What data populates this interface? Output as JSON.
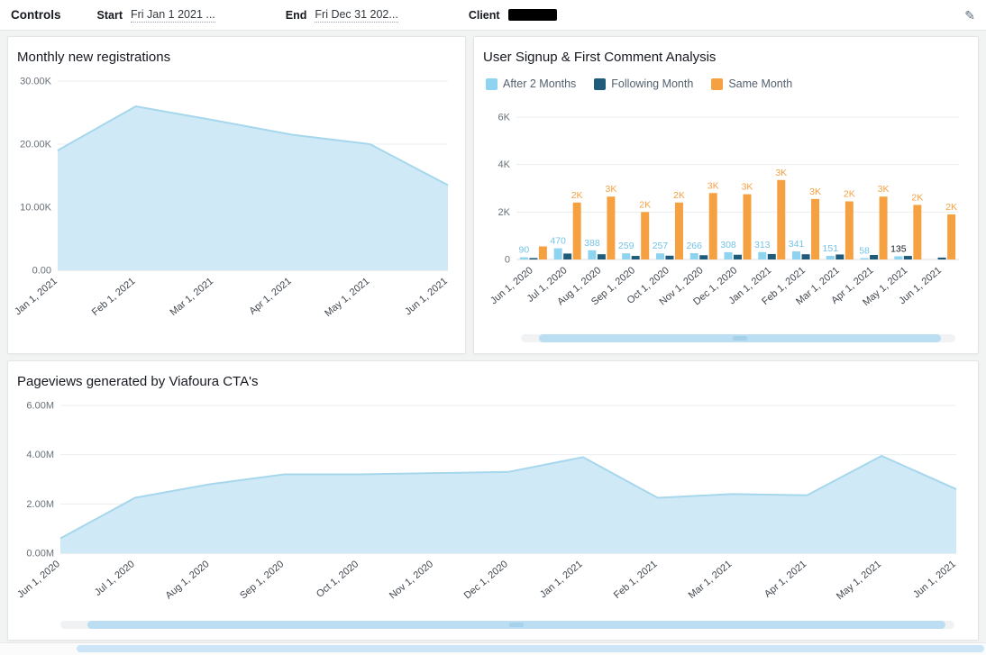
{
  "controls": {
    "title": "Controls",
    "start": {
      "label": "Start",
      "value": "Fri Jan 1 2021 ..."
    },
    "end": {
      "label": "End",
      "value": "Fri Dec 31 202..."
    },
    "client": {
      "label": "Client"
    },
    "edit_icon": "pencil"
  },
  "colors": {
    "area_fill": "#cfe9f6",
    "area_stroke": "#a6d7ec",
    "bar_light_blue": "#8ed3ef",
    "bar_navy": "#1f5b7a",
    "bar_orange": "#f5a142",
    "scroll_thumb": "#bcdef2"
  },
  "chart_data": [
    {
      "id": "monthly-new-registrations",
      "type": "area",
      "title": "Monthly new registrations",
      "categories": [
        "Jan 1, 2021",
        "Feb 1, 2021",
        "Mar 1, 2021",
        "Apr 1, 2021",
        "May 1, 2021",
        "Jun 1, 2021"
      ],
      "values": [
        19000,
        26000,
        23800,
        21500,
        20000,
        13500
      ],
      "ylim": [
        0,
        30000
      ],
      "yticks": [
        {
          "v": 0,
          "label": "0.00"
        },
        {
          "v": 10000,
          "label": "10.00K"
        },
        {
          "v": 20000,
          "label": "20.00K"
        },
        {
          "v": 30000,
          "label": "30.00K"
        }
      ],
      "fill": "#cfe9f6",
      "stroke": "#a6d7ec",
      "grid": true,
      "legend": "none"
    },
    {
      "id": "user-signup-first-comment",
      "type": "bar",
      "title": "User Signup & First Comment Analysis",
      "categories": [
        "Jun 1, 2020",
        "Jul 1, 2020",
        "Aug 1, 2020",
        "Sep 1, 2020",
        "Oct 1, 2020",
        "Nov 1, 2020",
        "Dec 1, 2020",
        "Jan 1, 2021",
        "Feb 1, 2021",
        "Mar 1, 2021",
        "Apr 1, 2021",
        "May 1, 2021",
        "Jun 1, 2021"
      ],
      "series": [
        {
          "name": "After 2 Months",
          "color": "#8ed3ef",
          "values": [
            90,
            470,
            388,
            259,
            257,
            266,
            308,
            313,
            341,
            151,
            58,
            135,
            0
          ],
          "labels": [
            "90",
            "470",
            "388",
            "259",
            "257",
            "266",
            "308",
            "313",
            "341",
            "151",
            "58",
            "135",
            ""
          ],
          "label_color": "#74c3e8",
          "label_colors": {
            "11": "#16191f"
          }
        },
        {
          "name": "Following Month",
          "color": "#1f5b7a",
          "values": [
            60,
            250,
            220,
            150,
            160,
            180,
            200,
            230,
            220,
            210,
            190,
            150,
            80
          ],
          "labels": []
        },
        {
          "name": "Same Month",
          "color": "#f5a142",
          "values": [
            550,
            2400,
            2650,
            2000,
            2400,
            2800,
            2750,
            3350,
            2550,
            2450,
            2650,
            2300,
            1900
          ],
          "labels": [
            "",
            "2K",
            "3K",
            "2K",
            "2K",
            "3K",
            "3K",
            "3K",
            "3K",
            "2K",
            "3K",
            "2K",
            "2K"
          ],
          "label_color": "#f5a142"
        }
      ],
      "ylim": [
        0,
        6000
      ],
      "yticks": [
        {
          "v": 0,
          "label": "0"
        },
        {
          "v": 2000,
          "label": "2K"
        },
        {
          "v": 4000,
          "label": "4K"
        },
        {
          "v": 6000,
          "label": "6K"
        }
      ],
      "grid": true,
      "legend": "top"
    },
    {
      "id": "pageviews-viafoura-cta",
      "type": "area",
      "title": "Pageviews generated by Viafoura CTA's",
      "categories": [
        "Jun 1, 2020",
        "Jul 1, 2020",
        "Aug 1, 2020",
        "Sep 1, 2020",
        "Oct 1, 2020",
        "Nov 1, 2020",
        "Dec 1, 2020",
        "Jan 1, 2021",
        "Feb 1, 2021",
        "Mar 1, 2021",
        "Apr 1, 2021",
        "May 1, 2021",
        "Jun 1, 2021"
      ],
      "values": [
        600000,
        2250000,
        2800000,
        3200000,
        3200000,
        3250000,
        3300000,
        3900000,
        2250000,
        2400000,
        2350000,
        3950000,
        2600000
      ],
      "ylim": [
        0,
        6000000
      ],
      "yticks": [
        {
          "v": 0,
          "label": "0.00M"
        },
        {
          "v": 2000000,
          "label": "2.00M"
        },
        {
          "v": 4000000,
          "label": "4.00M"
        },
        {
          "v": 6000000,
          "label": "6.00M"
        }
      ],
      "fill": "#cfe9f6",
      "stroke": "#a6d7ec",
      "grid": true,
      "legend": "none"
    }
  ]
}
